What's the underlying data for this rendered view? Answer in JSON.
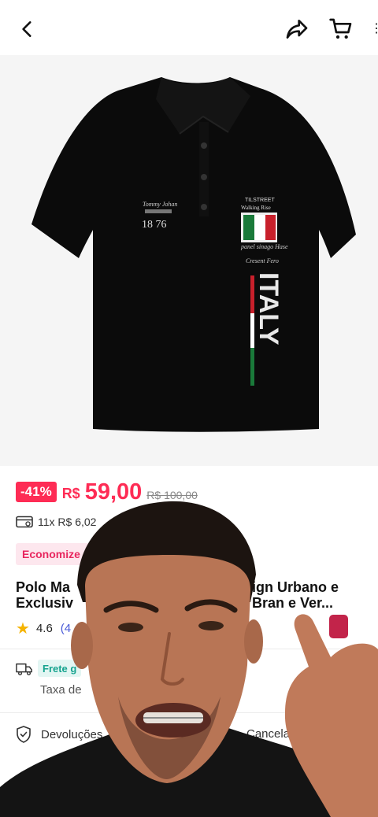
{
  "header": {
    "back_icon": "chevron-left-icon",
    "share_icon": "share-icon",
    "cart_icon": "cart-icon"
  },
  "product": {
    "shirt_text": {
      "brand_left": "Tommy Johan",
      "year": "18  76",
      "badge_line1": "TILSTREET",
      "badge_line2": "Walking Rise",
      "script_line1": "panel sinago Hase",
      "script_line2": "Cresent Fero",
      "vertical": "ITALY"
    },
    "gallery_arrow": "›"
  },
  "pricing": {
    "discount": "-41%",
    "currency": "R$",
    "price": "59,00",
    "old_price": "R$ 100,00",
    "installments": "11x R$ 6,02"
  },
  "promo": {
    "economize": "Economize"
  },
  "title": {
    "left_line1": "Polo Ma",
    "left_line2": "Exclusiv",
    "right_line1": "ign Urbano e",
    "right_line2": "Bran  e Ver..."
  },
  "rating": {
    "value": "4.6",
    "count": "(4"
  },
  "shipping": {
    "frete": "Frete g",
    "taxa": "Taxa de"
  },
  "returns": {
    "label": "Devoluções",
    "cancel": "Cancelamen"
  },
  "colors": {
    "accent": "#fe2c55",
    "frete_green": "#16a38f"
  }
}
